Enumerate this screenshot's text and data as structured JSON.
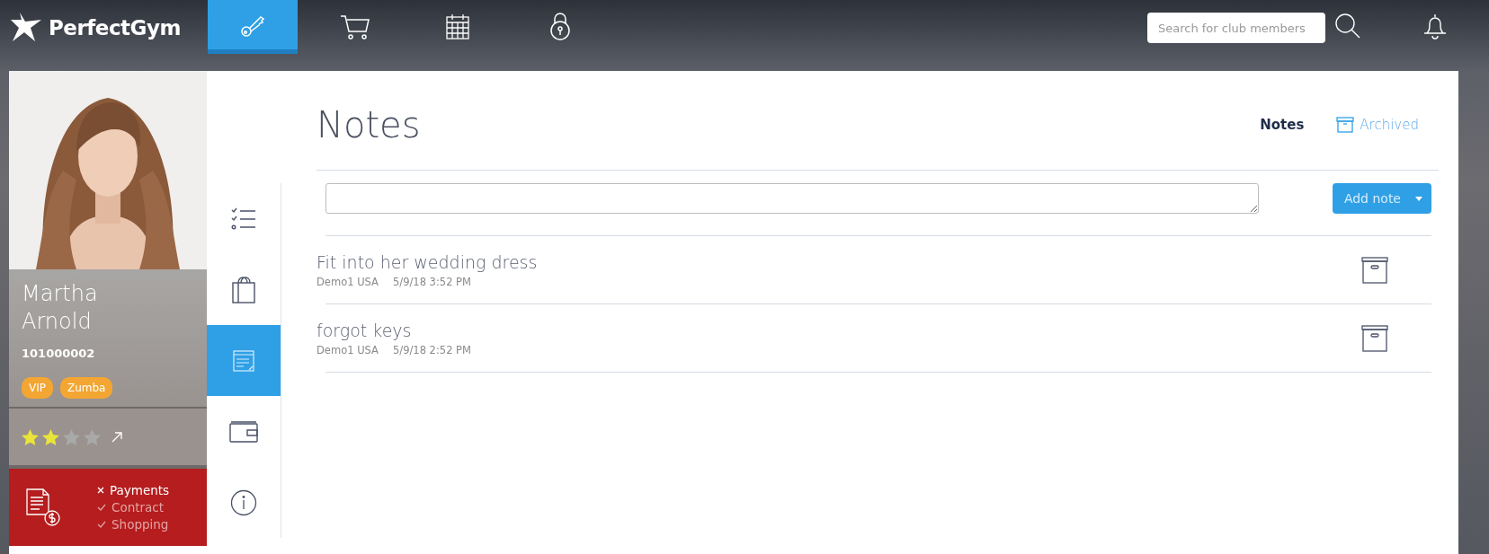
{
  "brand": "PerfectGym",
  "top_nav": [
    {
      "kind": "key",
      "selected": true
    },
    {
      "kind": "cart",
      "selected": false
    },
    {
      "kind": "calendar",
      "selected": false
    },
    {
      "kind": "lock",
      "selected": false
    }
  ],
  "search": {
    "placeholder": "Search for club members"
  },
  "member": {
    "name_lines": [
      "Martha",
      "Arnold"
    ],
    "number": "101000002",
    "tags": [
      "VIP",
      "Zumba"
    ],
    "stars": 2
  },
  "alerts": [
    {
      "label": "Payments",
      "ok": false
    },
    {
      "label": "Contract",
      "ok": true
    },
    {
      "label": "Shopping",
      "ok": true
    }
  ],
  "side_nav": [
    {
      "kind": "checklist",
      "selected": false
    },
    {
      "kind": "bag",
      "selected": false
    },
    {
      "kind": "notes",
      "selected": true
    },
    {
      "kind": "wallet",
      "selected": false
    },
    {
      "kind": "info",
      "selected": false
    }
  ],
  "page": {
    "title": "Notes",
    "view_tabs": [
      {
        "label": "Notes",
        "kind": "plain",
        "selected": true
      },
      {
        "label": "Archived",
        "kind": "archive",
        "selected": false
      }
    ]
  },
  "composer": {
    "button": "Add note"
  },
  "notes": [
    {
      "text": "Fit into her wedding dress",
      "author": "Demo1 USA",
      "time": "5/9/18 3:52 PM"
    },
    {
      "text": "forgot keys",
      "author": "Demo1 USA",
      "time": "5/9/18 2:52 PM"
    }
  ]
}
